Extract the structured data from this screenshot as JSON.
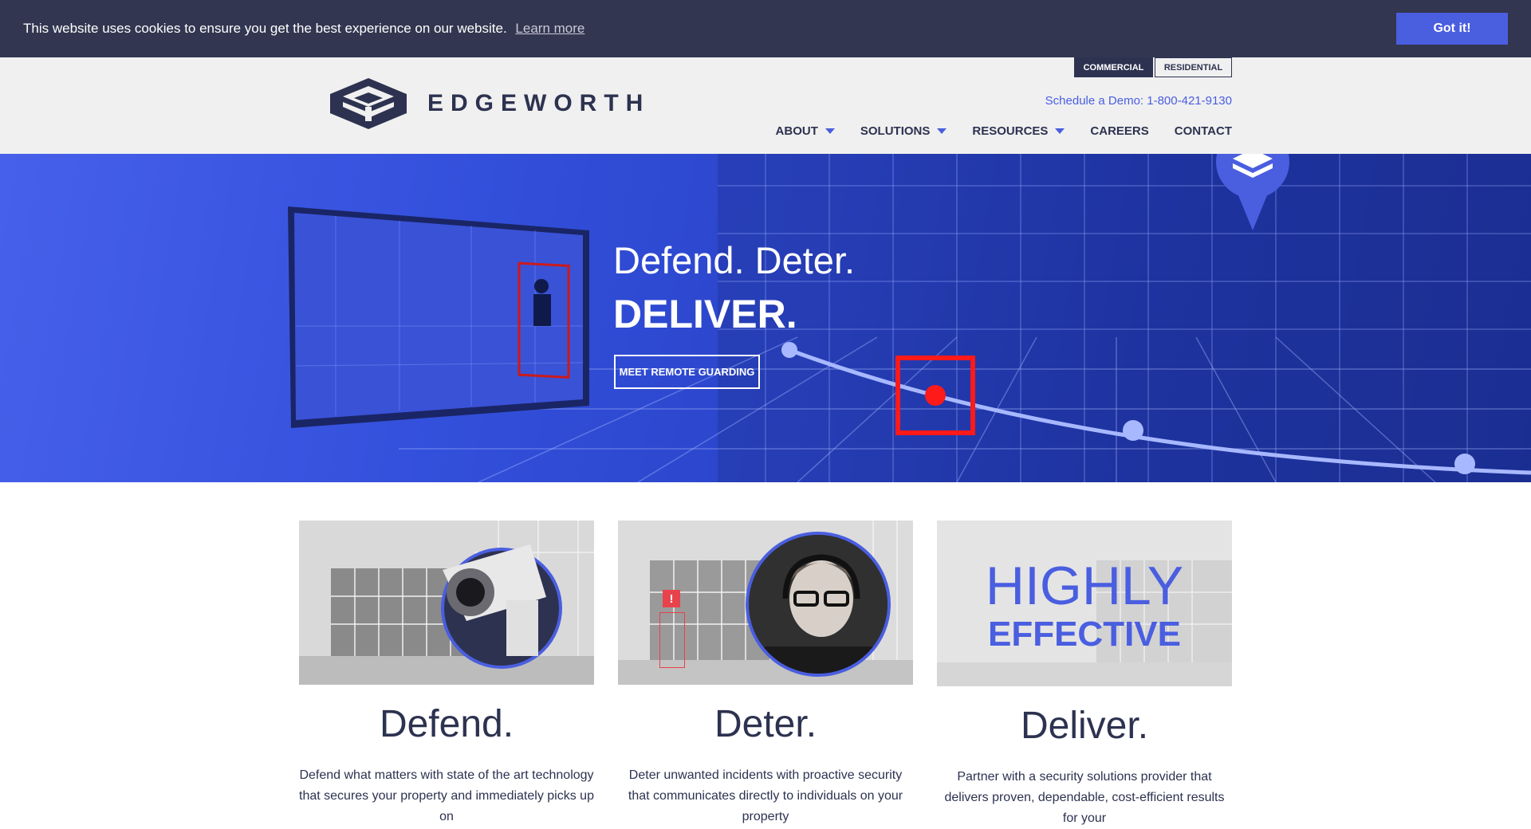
{
  "cookie": {
    "message": "This website uses cookies to ensure you get the best experience on our website.",
    "learn_more": "Learn more",
    "accept": "Got it!"
  },
  "header": {
    "logo_text": "EDGEWORTH",
    "segments": {
      "commercial": "COMMERCIAL",
      "residential": "RESIDENTIAL"
    },
    "demo": "Schedule a Demo: 1-800-421-9130",
    "nav": [
      {
        "label": "ABOUT",
        "has_menu": true
      },
      {
        "label": "SOLUTIONS",
        "has_menu": true
      },
      {
        "label": "RESOURCES",
        "has_menu": true
      },
      {
        "label": "CAREERS",
        "has_menu": false
      },
      {
        "label": "CONTACT",
        "has_menu": false
      }
    ]
  },
  "hero": {
    "title": "Defend. Deter.",
    "strong": "DELIVER.",
    "button": "MEET REMOTE GUARDING"
  },
  "cards": [
    {
      "title": "Defend.",
      "text": "Defend what matters with state of the art technology that secures your property and immediately picks up on"
    },
    {
      "title": "Deter.",
      "text": "Deter unwanted incidents with proactive security that communicates directly to individuals on your property"
    },
    {
      "title": "Deliver.",
      "text": "Partner with a security solutions provider that delivers proven, dependable, cost-efficient results for your"
    }
  ],
  "card3_image": {
    "line1": "HIGHLY",
    "line2": "EFFECTIVE"
  },
  "card2_alert": "!",
  "colors": {
    "navy": "#2d3250",
    "accent": "#4a5ee0",
    "cookie_bg": "#323650",
    "alert": "#e8424c"
  }
}
